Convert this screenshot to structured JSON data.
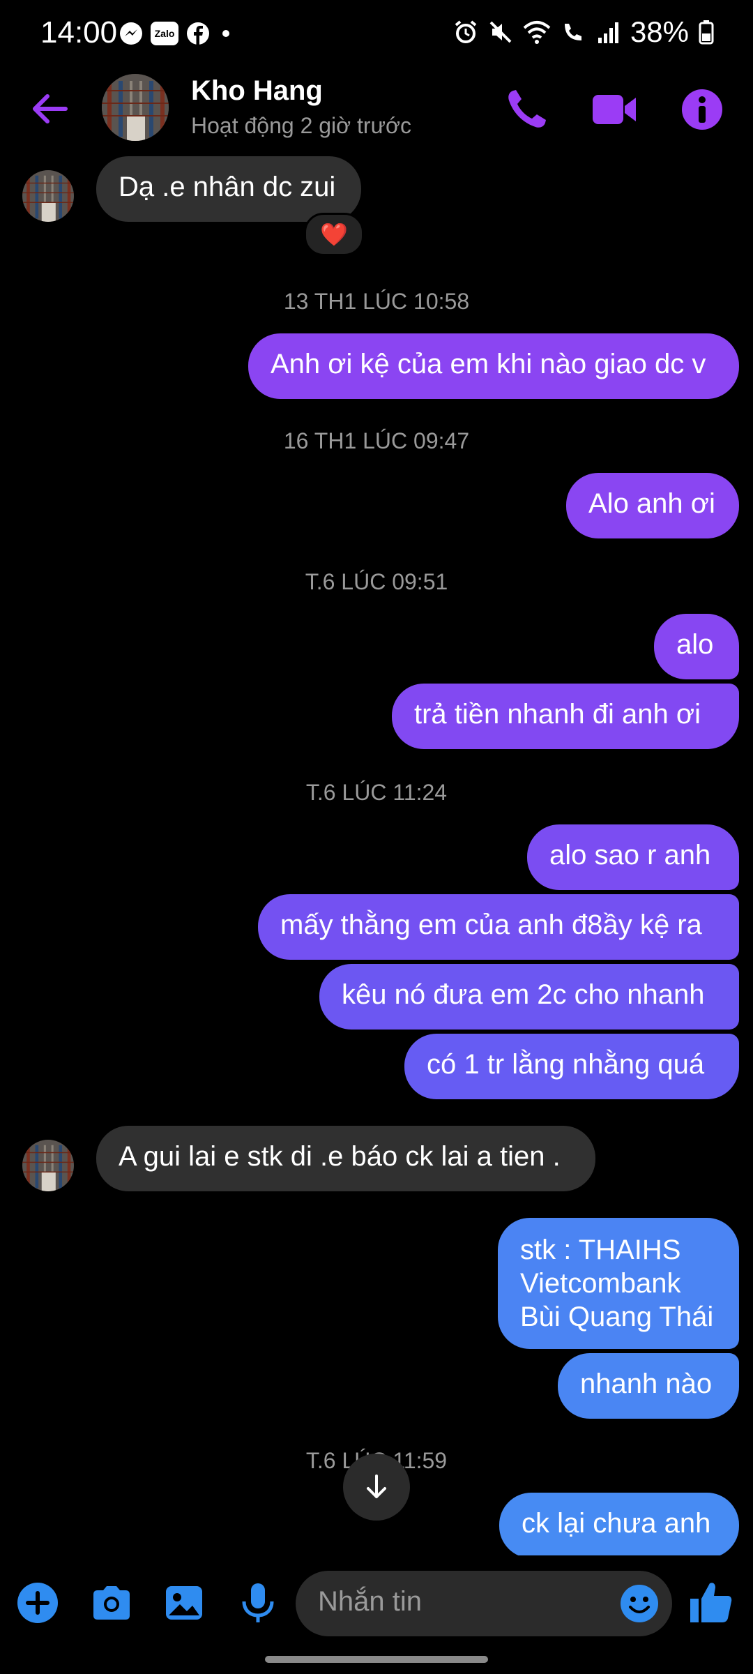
{
  "status_bar": {
    "time": "14:00",
    "left_icons": [
      "messenger-icon",
      "zalo-icon",
      "facebook-icon",
      "dot-icon"
    ],
    "zalo_text": "Zalo",
    "right_icons": [
      "alarm-icon",
      "mute-icon",
      "wifi-icon",
      "wifi-call-icon",
      "signal-icon"
    ],
    "battery": "38%"
  },
  "header": {
    "name": "Kho Hang",
    "status": "Hoạt động 2 giờ trước",
    "accent": "#9b3cf5"
  },
  "messages": [
    {
      "type": "in",
      "text": "Dạ .e nhân dc zui",
      "reaction": "❤️"
    },
    {
      "type": "timestamp",
      "text": "13 TH1 LÚC 10:58"
    },
    {
      "type": "out",
      "text": "Anh ơi kệ của em khi nào giao dc v"
    },
    {
      "type": "timestamp",
      "text": "16 TH1 LÚC 09:47"
    },
    {
      "type": "out",
      "text": "Alo anh ơi"
    },
    {
      "type": "timestamp",
      "text": "T.6 LÚC 09:51"
    },
    {
      "type": "out",
      "text": "alo"
    },
    {
      "type": "out",
      "text": "trả tiền nhanh đi anh ơi"
    },
    {
      "type": "timestamp",
      "text": "T.6 LÚC 11:24"
    },
    {
      "type": "out",
      "text": "alo sao r anh"
    },
    {
      "type": "out",
      "text": "mấy thằng em của anh đ8ầy kệ ra"
    },
    {
      "type": "out",
      "text": "kêu nó đưa em 2c cho nhanh"
    },
    {
      "type": "out",
      "text": "có 1 tr lằng nhằng quá"
    },
    {
      "type": "in",
      "text": "A gui lai e stk di .e báo ck lai a tien ."
    },
    {
      "type": "out",
      "lines": [
        "stk : THAIHS",
        "Vietcombank",
        "Bùi Quang Thái"
      ]
    },
    {
      "type": "out",
      "text": "nhanh nào"
    },
    {
      "type": "timestamp",
      "text": "T.6 LÚC 11:59"
    },
    {
      "type": "out",
      "text": "ck lại chưa anh"
    }
  ],
  "composer": {
    "placeholder": "Nhắn tin",
    "icons": [
      "plus-icon",
      "camera-icon",
      "gallery-icon",
      "mic-icon",
      "emoji-icon",
      "like-icon"
    ],
    "icon_color": "#2f8cf0"
  },
  "colors": {
    "bubble_in": "#303030",
    "purple": "#8b45f2",
    "blue": "#4b84f3"
  }
}
